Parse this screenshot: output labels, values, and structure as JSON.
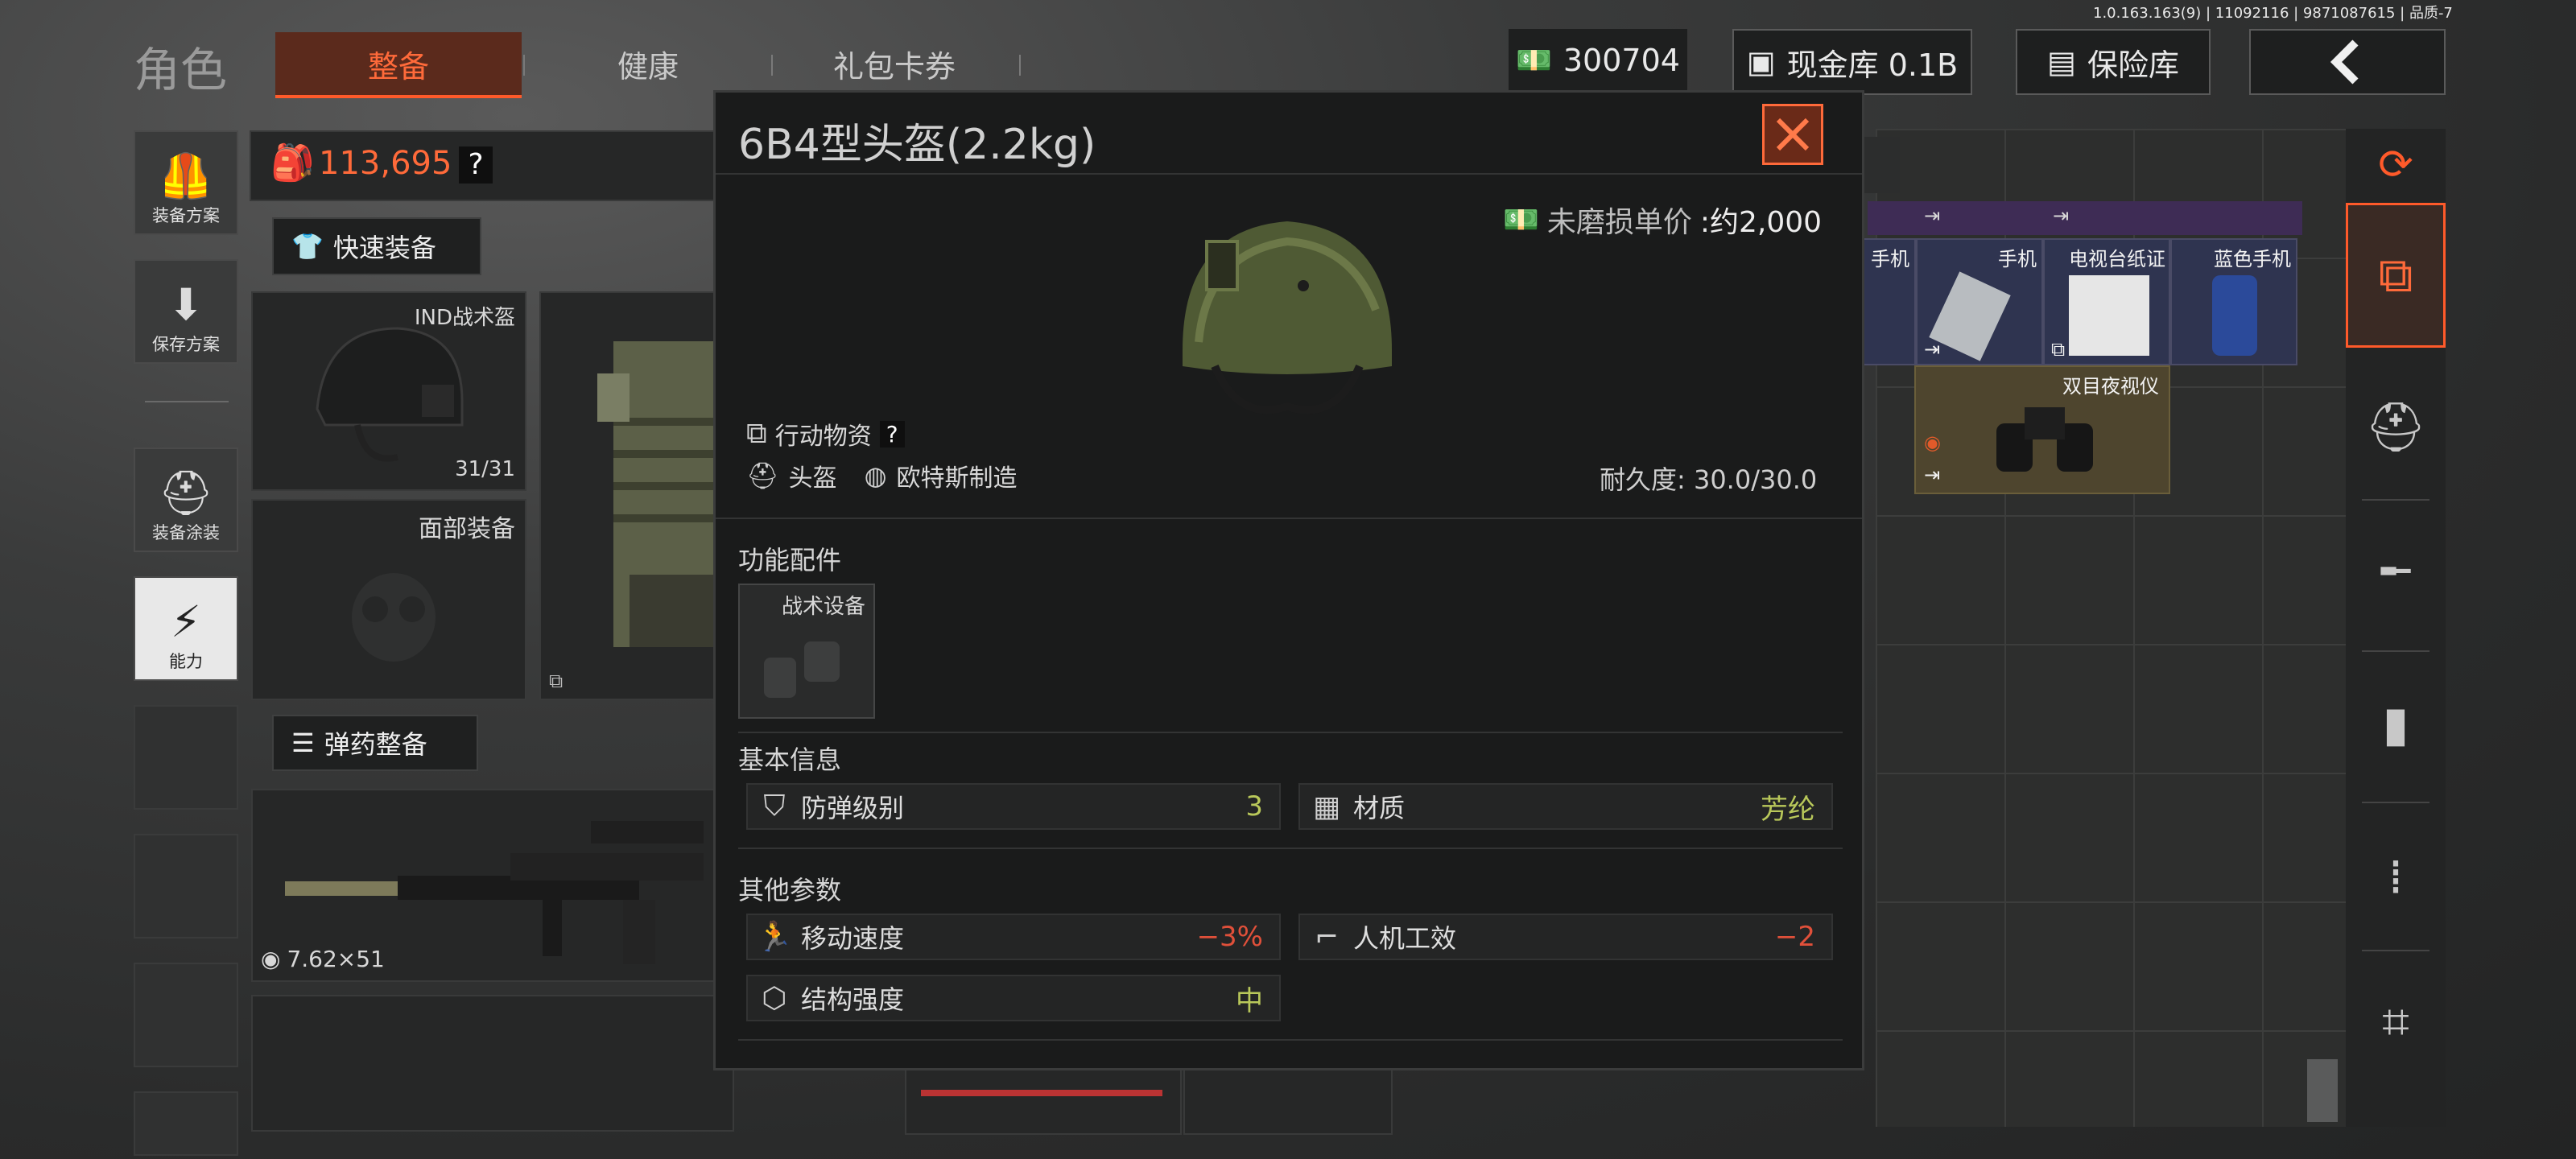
{
  "version_text": "1.0.163.163(9) | 11092116 | 9871087615 | 品质-7",
  "top": {
    "section_title": "角色",
    "tabs": [
      "整备",
      "健康",
      "礼包卡券"
    ],
    "currency": "300704",
    "cash_vault": "现金库 0.1B",
    "safe_box": "保险库"
  },
  "left_rail": [
    {
      "label": "装备方案",
      "icon": "vest-icon"
    },
    {
      "label": "保存方案",
      "icon": "download-icon"
    },
    {
      "label": "装备涂装",
      "icon": "spray-icon"
    },
    {
      "label": "能力",
      "icon": "lightning-icon"
    }
  ],
  "loadout": {
    "value": "113,695",
    "help": "?",
    "quick_equip": "快速装备",
    "helmet_label": "IND战术盔",
    "helmet_durability": "31/31",
    "face_label": "面部装备",
    "ammo_equip": "弹药整备",
    "caliber": "7.62×51"
  },
  "grid": {
    "items": [
      {
        "label": "手机"
      },
      {
        "label": "手机"
      },
      {
        "label": "电视台纸证"
      },
      {
        "label": "蓝色手机"
      },
      {
        "label": "双目夜视仪"
      }
    ]
  },
  "modal": {
    "title": "6B4型头盔(2.2kg)",
    "price_label": "未磨损单价",
    "price_value": ":约2,000",
    "tag_action": "行动物资",
    "tag_help": "?",
    "tag_type": "头盔",
    "tag_maker": "欧特斯制造",
    "durability": "耐久度: 30.0/30.0",
    "accessory_section": "功能配件",
    "accessory_slot": "战术设备",
    "basic_section": "基本信息",
    "basic_stats": [
      {
        "name": "防弹级别",
        "value": "3"
      },
      {
        "name": "材质",
        "value": "芳纶"
      }
    ],
    "other_section": "其他参数",
    "other_stats": [
      {
        "name": "移动速度",
        "value": "−3%"
      },
      {
        "name": "人机工效",
        "value": "−2"
      },
      {
        "name": "结构强度",
        "value": "中"
      }
    ]
  },
  "colors": {
    "accent": "#ff5a2a",
    "good": "#b9c85a",
    "bad": "#e0503a"
  }
}
